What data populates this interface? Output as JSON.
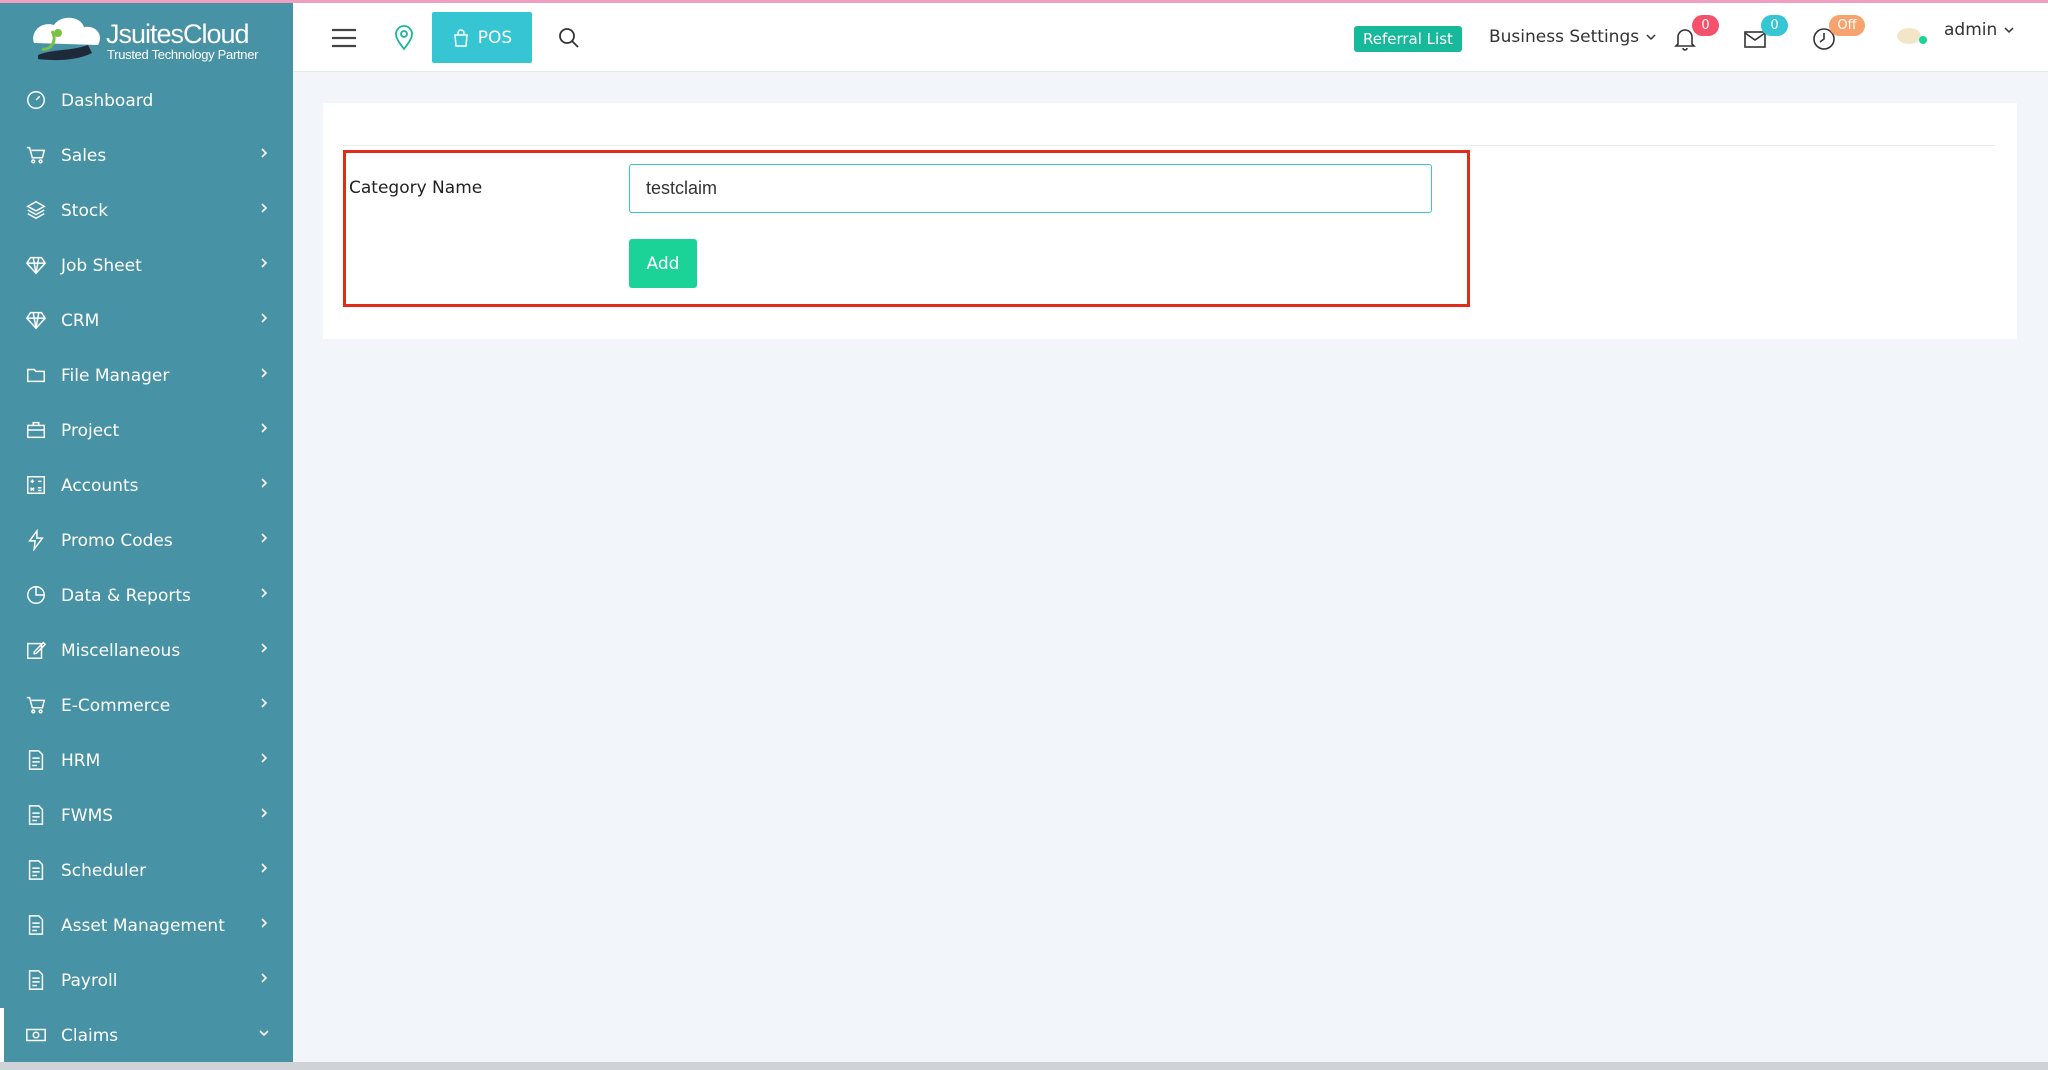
{
  "brand": {
    "title": "JsuitesCloud",
    "subtitle": "Trusted Technology Partner"
  },
  "sidebar": {
    "items": [
      {
        "label": "Dashboard",
        "icon": "dashboard-gauge-icon",
        "has_arrow": false
      },
      {
        "label": "Sales",
        "icon": "cart-icon",
        "has_arrow": true
      },
      {
        "label": "Stock",
        "icon": "layers-icon",
        "has_arrow": true
      },
      {
        "label": "Job Sheet",
        "icon": "diamond-icon",
        "has_arrow": true
      },
      {
        "label": "CRM",
        "icon": "diamond-icon",
        "has_arrow": true
      },
      {
        "label": "File Manager",
        "icon": "folder-icon",
        "has_arrow": true
      },
      {
        "label": "Project",
        "icon": "briefcase-icon",
        "has_arrow": true
      },
      {
        "label": "Accounts",
        "icon": "calculator-icon",
        "has_arrow": true
      },
      {
        "label": "Promo Codes",
        "icon": "lightning-icon",
        "has_arrow": true
      },
      {
        "label": "Data & Reports",
        "icon": "pie-chart-icon",
        "has_arrow": true
      },
      {
        "label": "Miscellaneous",
        "icon": "edit-icon",
        "has_arrow": true
      },
      {
        "label": "E-Commerce",
        "icon": "cart-icon",
        "has_arrow": true
      },
      {
        "label": "HRM",
        "icon": "document-icon",
        "has_arrow": true
      },
      {
        "label": "FWMS",
        "icon": "document-icon",
        "has_arrow": true
      },
      {
        "label": "Scheduler",
        "icon": "document-icon",
        "has_arrow": true
      },
      {
        "label": "Asset Management",
        "icon": "document-icon",
        "has_arrow": true
      },
      {
        "label": "Payroll",
        "icon": "document-icon",
        "has_arrow": true
      },
      {
        "label": "Claims",
        "icon": "money-icon",
        "has_arrow": true,
        "expanded": true
      }
    ]
  },
  "header": {
    "pos_label": "POS",
    "referral_label": "Referral List",
    "business_settings_label": "Business Settings",
    "notifications_count": "0",
    "messages_count": "0",
    "clock_status": "Off",
    "user_label": "admin"
  },
  "form": {
    "category_label": "Category Name",
    "category_value": "testclaim",
    "add_label": "Add"
  },
  "colors": {
    "sidebar": "#4792a5",
    "pos_button": "#36c6d3",
    "referral": "#18b89b",
    "add_button": "#1bd396",
    "highlight_border": "#e32b1b"
  }
}
